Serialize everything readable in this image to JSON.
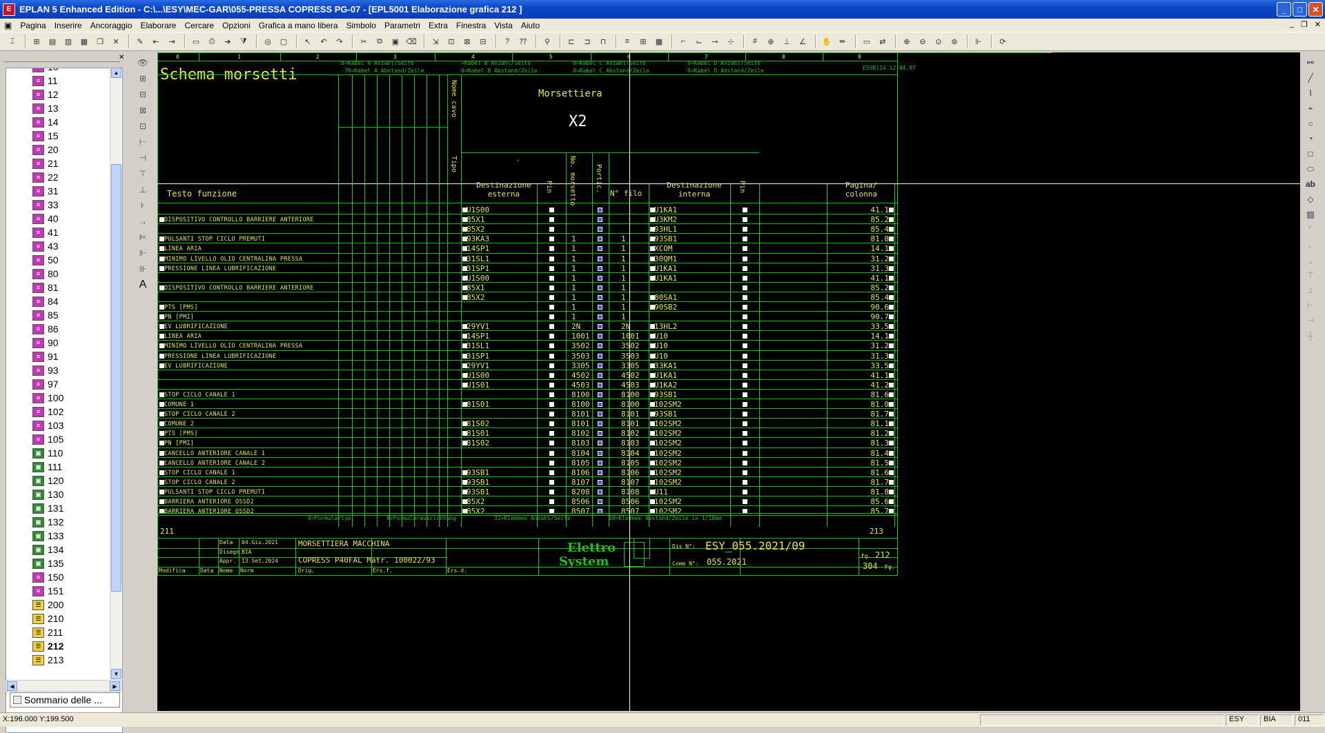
{
  "window": {
    "title": "EPLAN 5 Enhanced Edition - C:\\...\\ESY\\MEC-GAR\\055-PRESSA COPRESS PG-07 - [EPL5001 Elaborazione grafica 212   ]",
    "btn_min": "_",
    "btn_max": "□",
    "btn_close": "✕"
  },
  "menu": [
    "Pagina",
    "Inserire",
    "Ancoraggio",
    "Elaborare",
    "Cercare",
    "Opzioni",
    "Grafica a mano libera",
    "Simbolo",
    "Parametri",
    "Extra",
    "Finestra",
    "Vista",
    "Aiuto"
  ],
  "tree": {
    "items": [
      {
        "label": "10",
        "icon": "pg"
      },
      {
        "label": "11",
        "icon": "pg"
      },
      {
        "label": "12",
        "icon": "pg"
      },
      {
        "label": "13",
        "icon": "pg"
      },
      {
        "label": "14",
        "icon": "pg"
      },
      {
        "label": "15",
        "icon": "pg"
      },
      {
        "label": "20",
        "icon": "pg"
      },
      {
        "label": "21",
        "icon": "pg"
      },
      {
        "label": "22",
        "icon": "pg"
      },
      {
        "label": "31",
        "icon": "pg"
      },
      {
        "label": "33",
        "icon": "pg"
      },
      {
        "label": "40",
        "icon": "pg"
      },
      {
        "label": "41",
        "icon": "pg"
      },
      {
        "label": "43",
        "icon": "pg"
      },
      {
        "label": "50",
        "icon": "pg"
      },
      {
        "label": "80",
        "icon": "pg"
      },
      {
        "label": "81",
        "icon": "pg"
      },
      {
        "label": "84",
        "icon": "pg"
      },
      {
        "label": "85",
        "icon": "pg"
      },
      {
        "label": "86",
        "icon": "pg"
      },
      {
        "label": "90",
        "icon": "pg"
      },
      {
        "label": "91",
        "icon": "pg"
      },
      {
        "label": "93",
        "icon": "pg"
      },
      {
        "label": "97",
        "icon": "pg"
      },
      {
        "label": "100",
        "icon": "pg"
      },
      {
        "label": "102",
        "icon": "pg"
      },
      {
        "label": "103",
        "icon": "pg"
      },
      {
        "label": "105",
        "icon": "pg"
      },
      {
        "label": "110",
        "icon": "gr"
      },
      {
        "label": "111",
        "icon": "gr"
      },
      {
        "label": "120",
        "icon": "gr"
      },
      {
        "label": "130",
        "icon": "gr"
      },
      {
        "label": "131",
        "icon": "gr"
      },
      {
        "label": "132",
        "icon": "gr"
      },
      {
        "label": "133",
        "icon": "gr"
      },
      {
        "label": "134",
        "icon": "gr"
      },
      {
        "label": "135",
        "icon": "gr"
      },
      {
        "label": "150",
        "icon": "pg"
      },
      {
        "label": "151",
        "icon": "pg"
      },
      {
        "label": "200",
        "icon": "yl"
      },
      {
        "label": "210",
        "icon": "yl"
      },
      {
        "label": "211",
        "icon": "yl"
      },
      {
        "label": "212",
        "icon": "yl",
        "selected": true
      },
      {
        "label": "213",
        "icon": "yl"
      }
    ],
    "tab_label": "Sommario delle ..."
  },
  "sheet": {
    "title": "Schema morsetti",
    "columns": [
      "0",
      "1",
      "2",
      "3",
      "4",
      "5",
      "6",
      "7",
      "8",
      "9"
    ],
    "header_notes": [
      "8=Kabel A Anzahl/Seite",
      "-70=Kabel A Abstand/Zeile",
      "=Kabel B Anzahl/Seite",
      "0=Kabel B Abstand/Zeile",
      "0=Kabel C Anzahl/Seite",
      "0=Kabel C Abstand/Zeile",
      "0=Kabel D Anzahl/Seite",
      "0=Kabel D Abstand/Zeile",
      "ESYK114 12.04.97"
    ],
    "nome_cavo": "Nome cavo",
    "tipo": "Tipo",
    "morsettiera_label": "Morsettiera",
    "morsettiera_id": "X2",
    "dot": ".",
    "hdr_testo": "Testo funzione",
    "hdr_dest_est": "Destinazione esterna",
    "hdr_pin1": "Pin",
    "hdr_nomors": "No. morsetto",
    "hdr_portic": "Portic.",
    "hdr_nfilo": "N° filo",
    "hdr_dest_int": "Destinazione interna",
    "hdr_pin2": "Pin",
    "hdr_pagina": "Pagina/ colonna",
    "footer_notes": [
      "0=Formulartyp",
      "0=Formularausrichtung",
      "32=Klemmen Anzahl/Seite",
      "50=Klemmen Abstand/Zeile in 1/10mm"
    ],
    "prev_page": "211",
    "next_page": "213",
    "tb_data_lbl": "Data",
    "tb_data_val": "04.Giu.2021",
    "tb_disegn_lbl": "Disegn",
    "tb_disegn_val": "BIA",
    "tb_appr_lbl": "Appr.",
    "tb_appr_val": "13.Set.2024",
    "tb_modifica": "Modifica",
    "tb_data2": "Data",
    "tb_nome": "Nome",
    "tb_norm": "Norm",
    "tb_title1": "MORSETTIERA MACCHINA",
    "tb_title2": "COPRESS P40FAL Matr. 100022/93",
    "tb_drig": "Drig.",
    "tb_ersf": "Ers.f.",
    "tb_ersd": "Ers.d.",
    "tb_logo1": "Elettro",
    "tb_logo2": "System",
    "tb_dis_lbl": "Dis N°:",
    "tb_dis_val": "ESY_055.2021/09",
    "tb_comm_lbl": "Comm N°:",
    "tb_comm_val": "055.2021",
    "tb_fg_lbl": "Fg.",
    "tb_fg_val": "212",
    "tb_fg_tot": "304",
    "tb_fg_tot_lbl": "Fg."
  },
  "rows": [
    {
      "fn": "",
      "est": "U1S00",
      "no": "",
      "filo": "",
      "int": "U1KA1",
      "pg": "41.1"
    },
    {
      "fn": "DISPOSITIVO CONTROLLO BARRIERE ANTERIORE",
      "est": "85X1",
      "no": "",
      "filo": "",
      "int": "U3KM2",
      "pg": "85.2"
    },
    {
      "fn": "",
      "est": "85X2",
      "no": "",
      "filo": "",
      "int": "93HL1",
      "pg": "85.4"
    },
    {
      "fn": "PULSANTI STOP CICLO PREMUTI",
      "est": "93KA3",
      "no": "1",
      "filo": "1",
      "int": "93SB1",
      "pg": "81.8"
    },
    {
      "fn": "LINEA ARIA",
      "est": "14SP1",
      "no": "1",
      "filo": "1",
      "int": "XCOM",
      "pg": "14.1"
    },
    {
      "fn": "MINIMO LIVELLO OLIO CENTRALINA PRESSA",
      "est": "31SL1",
      "no": "1",
      "filo": "1",
      "int": "30QM1",
      "pg": "31.2"
    },
    {
      "fn": "PRESSIONE LINEA LUBRIFICAZIONE",
      "est": "31SP1",
      "no": "1",
      "filo": "1",
      "int": "U1KA1",
      "pg": "31.3"
    },
    {
      "fn": "",
      "est": "U1S00",
      "no": "1",
      "filo": "1",
      "int": "U1KA1",
      "pg": "41.1"
    },
    {
      "fn": "DISPOSITIVO CONTROLLO BARRIERE ANTERIORE",
      "est": "85X1",
      "no": "1",
      "filo": "1",
      "int": "",
      "pg": "85.2"
    },
    {
      "fn": "",
      "est": "85X2",
      "no": "1",
      "filo": "1",
      "int": "80SA1",
      "pg": "85.4"
    },
    {
      "fn": "PTS [PMS]",
      "est": "",
      "no": "1",
      "filo": "1",
      "int": "90SB2",
      "pg": "90.6"
    },
    {
      "fn": "PN [PMI]",
      "est": "",
      "no": "1",
      "filo": "1",
      "int": "",
      "pg": "90.7"
    },
    {
      "fn": "EV LUBRIFICAZIONE",
      "est": "29YV1",
      "no": "2N",
      "filo": "2N",
      "int": "13HL2",
      "pg": "33.5"
    },
    {
      "fn": "LINEA ARIA",
      "est": "14SP1",
      "no": "1001",
      "filo": "1001",
      "int": "U10",
      "pg": "14.1"
    },
    {
      "fn": "MINIMO LIVELLO OLIO CENTRALINA PRESSA",
      "est": "31SL1",
      "no": "3502",
      "filo": "3502",
      "int": "U10",
      "pg": "31.2"
    },
    {
      "fn": "PRESSIONE LINEA LUBRIFICAZIONE",
      "est": "31SP1",
      "no": "3503",
      "filo": "3503",
      "int": "U10",
      "pg": "31.3"
    },
    {
      "fn": "EV LUBRIFICAZIONE",
      "est": "29YV1",
      "no": "3305",
      "filo": "3305",
      "int": "33KA1",
      "pg": "33.5"
    },
    {
      "fn": "",
      "est": "U1S00",
      "no": "4502",
      "filo": "4502",
      "int": "U1KA1",
      "pg": "41.1"
    },
    {
      "fn": "",
      "est": "U1S01",
      "no": "4503",
      "filo": "4503",
      "int": "U1KA2",
      "pg": "41.2"
    },
    {
      "fn": "STOP CICLO CANALE 1",
      "est": "",
      "no": "8100",
      "filo": "8100",
      "int": "93SB1",
      "pg": "81.6"
    },
    {
      "fn": "COMUNE 1",
      "est": "81S01",
      "no": "8100",
      "filo": "8100",
      "int": "102SM2",
      "pg": "81.0"
    },
    {
      "fn": "STOP CICLO CANALE 2",
      "est": "",
      "no": "8101",
      "filo": "8101",
      "int": "93SB1",
      "pg": "81.7"
    },
    {
      "fn": "COMUNE 2",
      "est": "81S02",
      "no": "8101",
      "filo": "8101",
      "int": "102SM2",
      "pg": "81.1"
    },
    {
      "fn": "PTS [PMS]",
      "est": "81S01",
      "no": "8102",
      "filo": "8102",
      "int": "102SM2",
      "pg": "81.2"
    },
    {
      "fn": "PN [PMI]",
      "est": "81S02",
      "no": "8103",
      "filo": "8103",
      "int": "102SM2",
      "pg": "81.3"
    },
    {
      "fn": "CANCELLO ANTERIORE CANALE 1",
      "est": "",
      "no": "8104",
      "filo": "8104",
      "int": "102SM2",
      "pg": "81.4"
    },
    {
      "fn": "CANCELLO ANTERIORE CANALE 2",
      "est": "",
      "no": "8105",
      "filo": "8105",
      "int": "102SM2",
      "pg": "81.5"
    },
    {
      "fn": "STOP CICLO CANALE 1",
      "est": "93SB1",
      "no": "8106",
      "filo": "8106",
      "int": "102SM2",
      "pg": "81.6"
    },
    {
      "fn": "STOP CICLO CANALE 2",
      "est": "93SB1",
      "no": "8107",
      "filo": "8107",
      "int": "102SM2",
      "pg": "81.7"
    },
    {
      "fn": "PULSANTI STOP CICLO PREMUTI",
      "est": "93SB1",
      "no": "8208",
      "filo": "8108",
      "int": "U11",
      "pg": "81.8"
    },
    {
      "fn": "BARRIERA ANTERIORE OSSD2",
      "est": "85X2",
      "no": "8506",
      "filo": "8506",
      "int": "102SM2",
      "pg": "85.6"
    },
    {
      "fn": "BARRIERA ANTERIORE OSSD2",
      "est": "85X2",
      "no": "8507",
      "filo": "8507",
      "int": "102SM2",
      "pg": "85.7"
    }
  ],
  "status": {
    "coords": "X:196.000 Y:199.500",
    "f1": "ESY",
    "f2": "BIA",
    "f3": "011"
  }
}
